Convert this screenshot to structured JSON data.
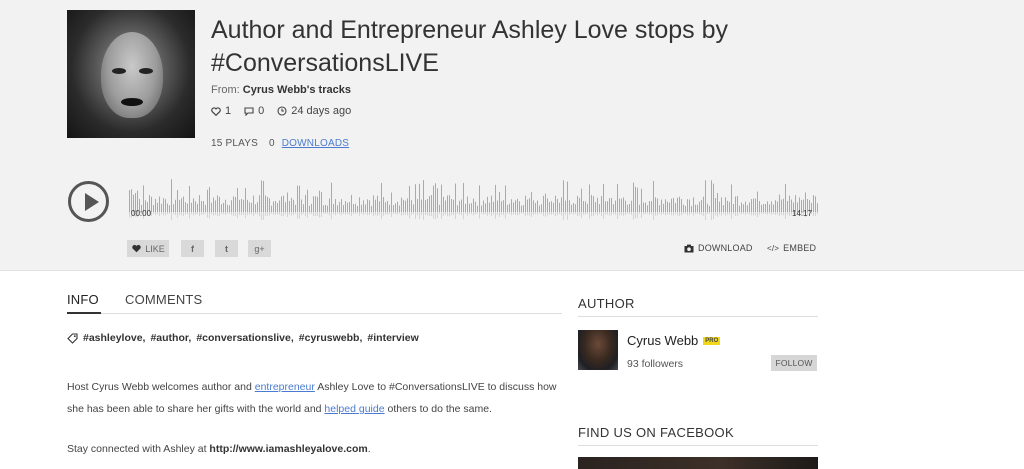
{
  "track": {
    "title": "Author and Entrepreneur Ashley Love stops by #ConversationsLIVE",
    "from_prefix": "From:",
    "from_name": "Cyrus Webb's tracks",
    "likes": "1",
    "comments": "0",
    "age": "24 days ago",
    "plays": "15 PLAYS",
    "downloads_count": "0",
    "downloads_label": "DOWNLOADS"
  },
  "player": {
    "time_start": "00:00",
    "time_end": "14:17"
  },
  "social": {
    "like_label": "LIKE",
    "facebook_glyph": "f",
    "twitter_glyph": "t",
    "gplus_glyph": "g+"
  },
  "actions": {
    "download_label": "DOWNLOAD",
    "embed_label": "EMBED"
  },
  "tabs": [
    {
      "label": "INFO",
      "active": true
    },
    {
      "label": "COMMENTS",
      "active": false
    }
  ],
  "info": {
    "tags": [
      "#ashleylove,",
      "#author,",
      "#conversationslive,",
      "#cyruswebb,",
      "#interview"
    ],
    "desc_p1": "Host Cyrus Webb welcomes author and ",
    "desc_link1": "entrepreneur",
    "desc_p2": " Ashley Love to #ConversationsLIVE to discuss how she has been able to share her gifts with the world and ",
    "desc_link2": "helped guide",
    "desc_p3": " others to do the same.",
    "stay_prefix": "Stay connected with Ashley at ",
    "stay_url": "http://www.iamashleyalove.com",
    "stay_suffix": "."
  },
  "author": {
    "heading": "AUTHOR",
    "name": "Cyrus Webb",
    "badge": "PRO",
    "followers": "93 followers",
    "follow_label": "FOLLOW"
  },
  "facebook": {
    "heading": "FIND US ON FACEBOOK"
  },
  "colors": {
    "link": "#4a7bd0",
    "pro_badge": "#f1d81a",
    "hero_bg": "#f2f2f2"
  }
}
